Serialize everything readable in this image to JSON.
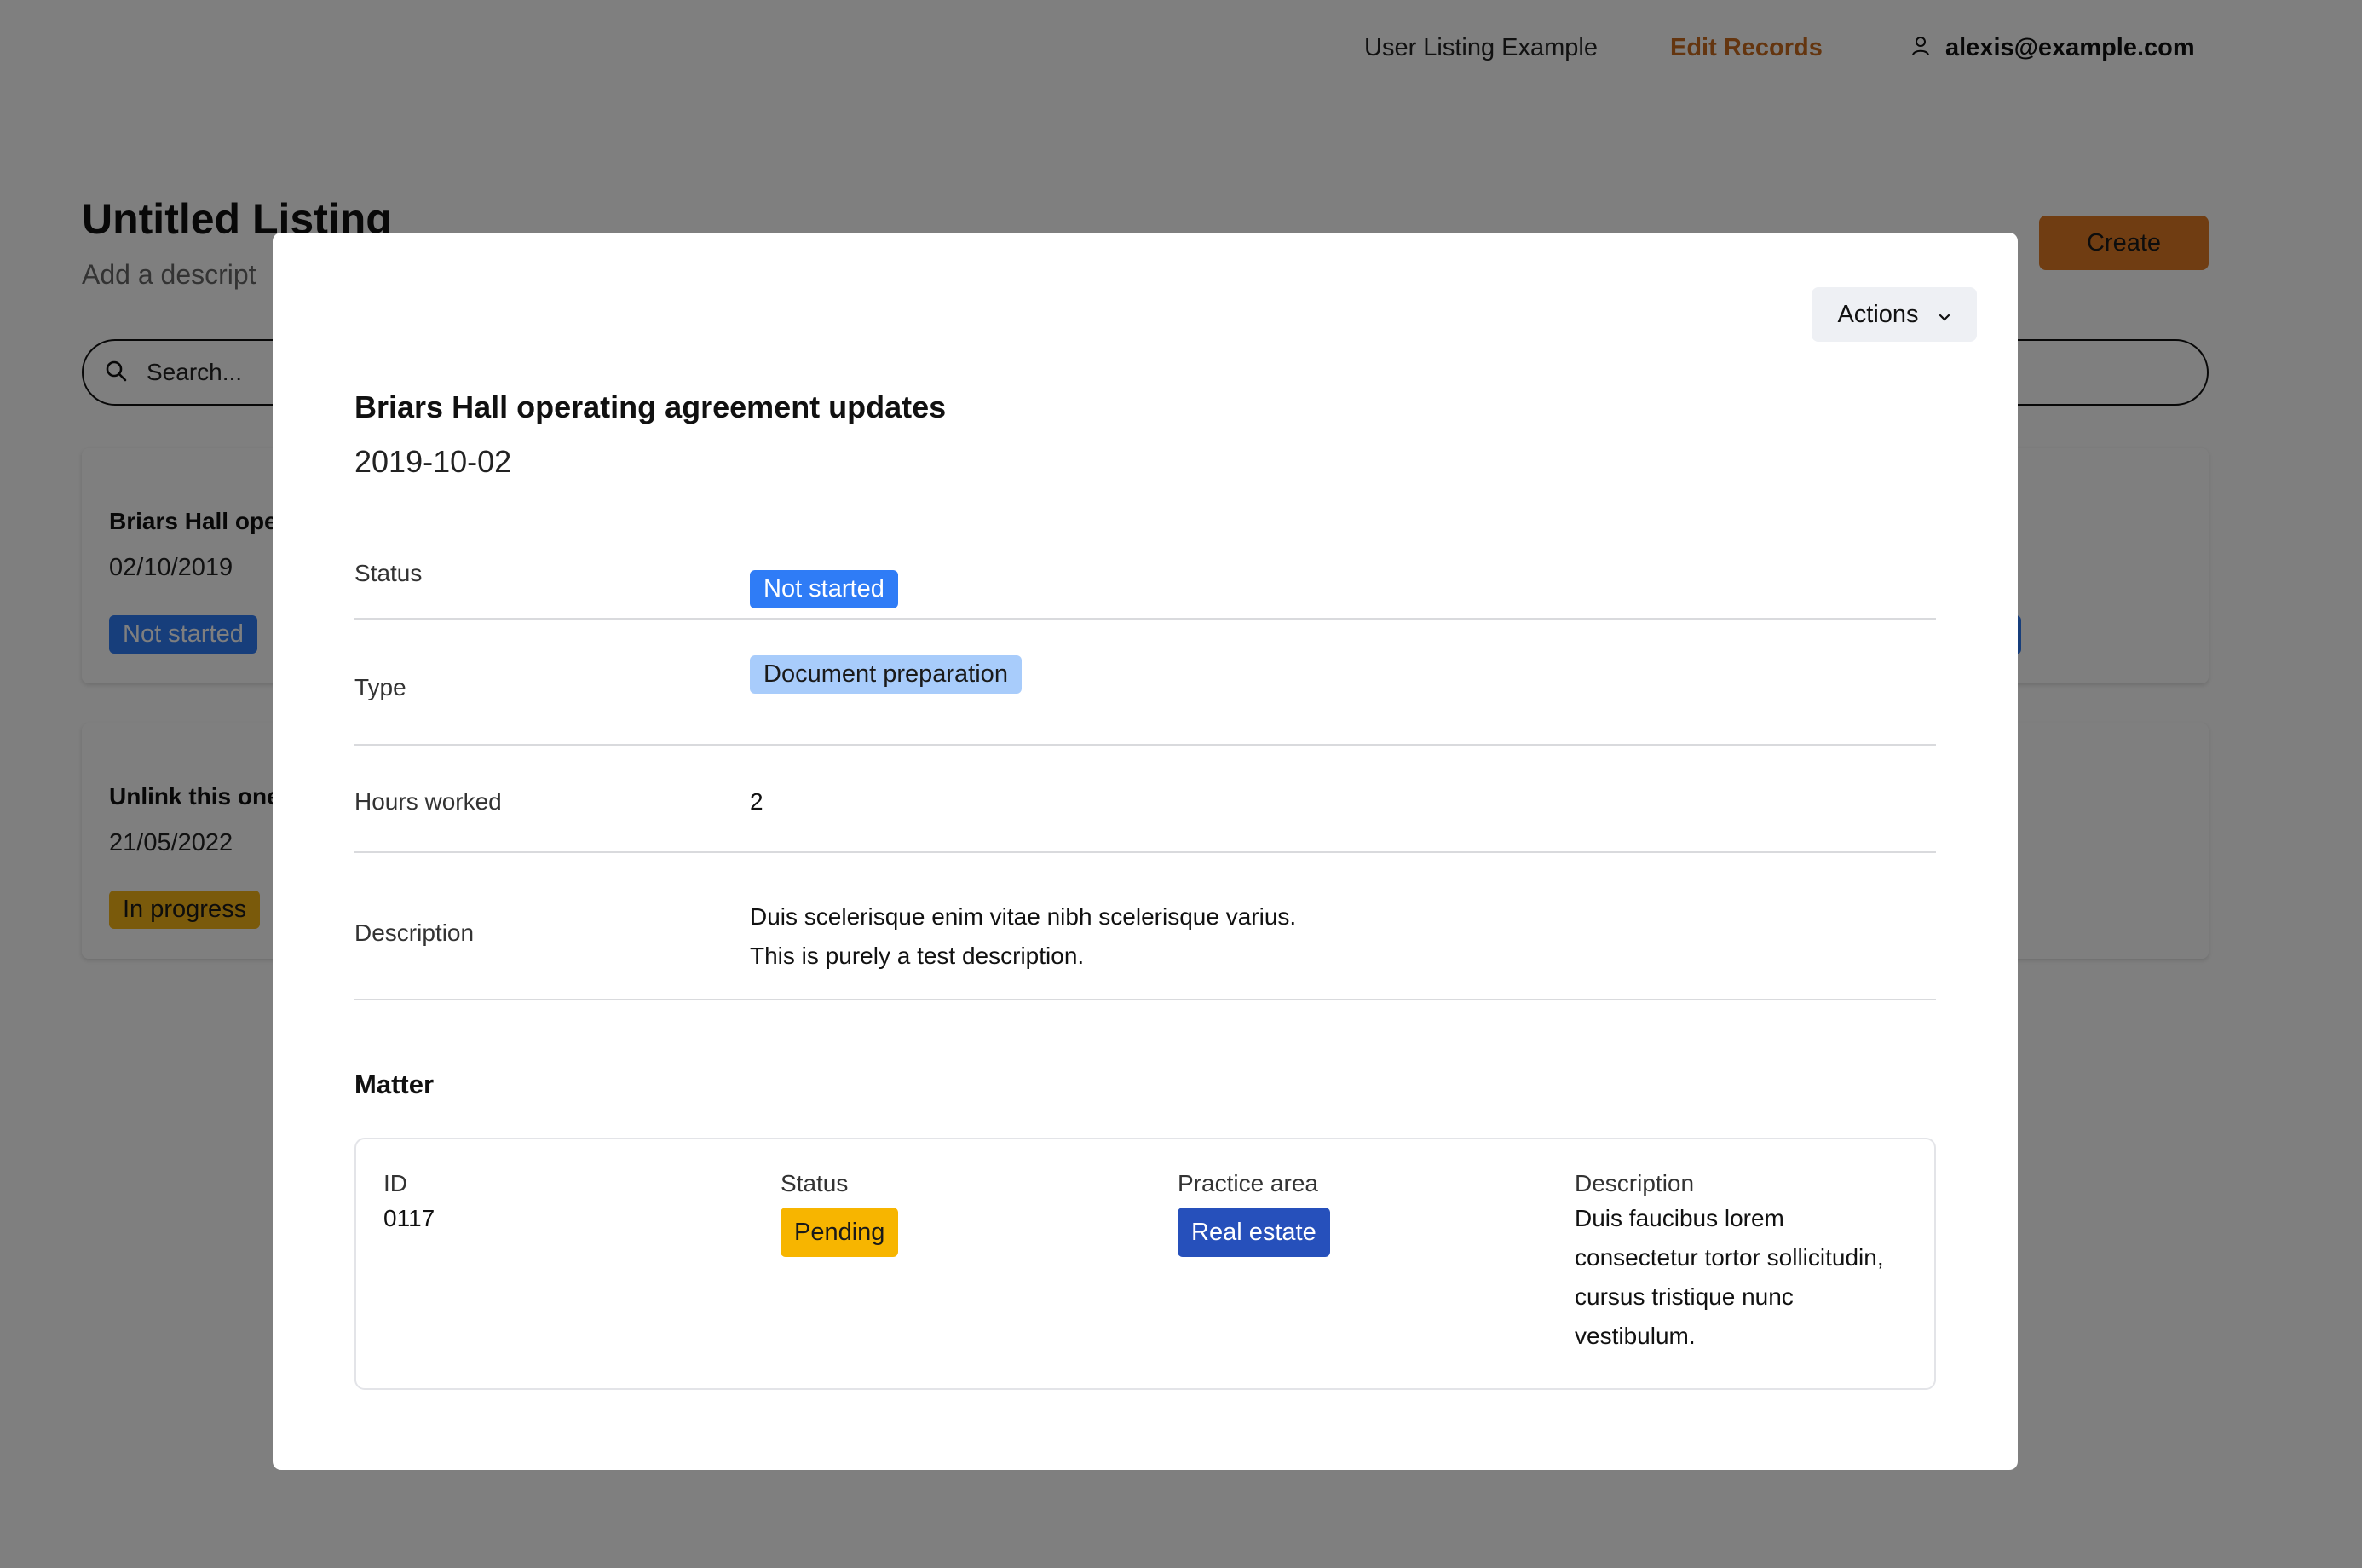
{
  "nav": {
    "listing_link": "User Listing Example",
    "edit_link": "Edit Records",
    "user_email": "alexis@example.com"
  },
  "page": {
    "title": "Untitled Listing",
    "description": "Add a descript",
    "create_label": "Create",
    "search_placeholder": "Search..."
  },
  "cards": [
    {
      "title": "Briars Hall oper",
      "date": "02/10/2019",
      "status": "Not started"
    },
    {
      "title": "Unlink this one",
      "date": "21/05/2022",
      "status": "In progress"
    }
  ],
  "modal": {
    "actions_label": "Actions",
    "title": "Briars Hall operating agreement updates",
    "date": "2019-10-02",
    "fields": {
      "status_label": "Status",
      "status_value": "Not started",
      "type_label": "Type",
      "type_value": "Document preparation",
      "hours_label": "Hours worked",
      "hours_value": "2",
      "description_label": "Description",
      "description_line1": "Duis scelerisque enim vitae nibh scelerisque varius.",
      "description_line2": "This is purely a test description."
    },
    "matter": {
      "heading": "Matter",
      "id_label": "ID",
      "id_value": "0117",
      "status_label": "Status",
      "status_value": "Pending",
      "practice_label": "Practice area",
      "practice_value": "Real estate",
      "description_label": "Description",
      "description_line1": "Duis faucibus lorem",
      "description_line2": "consectetur tortor sollicitudin,",
      "description_line3": "cursus tristique nunc",
      "description_line4": "vestibulum."
    }
  },
  "colors": {
    "accent_orange": "#e07a24",
    "status_blue": "#2f7cf6",
    "type_light_blue": "#a8ccfb",
    "pending_amber": "#f7b500",
    "practice_navy": "#2650bb"
  },
  "icons": {
    "user": "user-icon",
    "search": "search-icon",
    "chevron": "chevron-down-icon"
  }
}
